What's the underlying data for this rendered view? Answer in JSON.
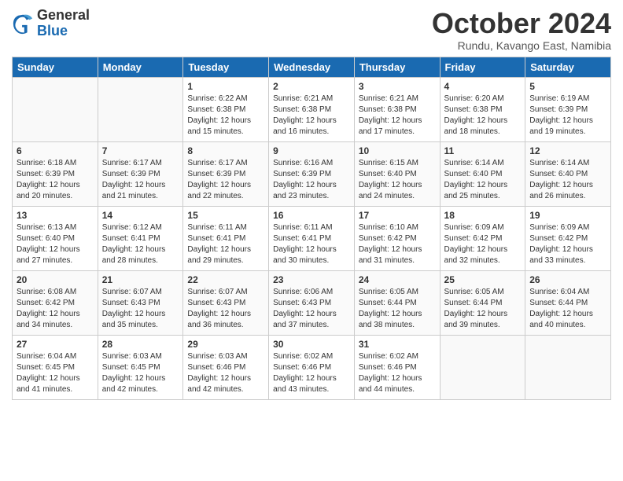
{
  "logo": {
    "general": "General",
    "blue": "Blue"
  },
  "header": {
    "month": "October 2024",
    "location": "Rundu, Kavango East, Namibia"
  },
  "days_of_week": [
    "Sunday",
    "Monday",
    "Tuesday",
    "Wednesday",
    "Thursday",
    "Friday",
    "Saturday"
  ],
  "weeks": [
    [
      {
        "day": "",
        "sunrise": "",
        "sunset": "",
        "daylight": ""
      },
      {
        "day": "",
        "sunrise": "",
        "sunset": "",
        "daylight": ""
      },
      {
        "day": "1",
        "sunrise": "Sunrise: 6:22 AM",
        "sunset": "Sunset: 6:38 PM",
        "daylight": "Daylight: 12 hours and 15 minutes."
      },
      {
        "day": "2",
        "sunrise": "Sunrise: 6:21 AM",
        "sunset": "Sunset: 6:38 PM",
        "daylight": "Daylight: 12 hours and 16 minutes."
      },
      {
        "day": "3",
        "sunrise": "Sunrise: 6:21 AM",
        "sunset": "Sunset: 6:38 PM",
        "daylight": "Daylight: 12 hours and 17 minutes."
      },
      {
        "day": "4",
        "sunrise": "Sunrise: 6:20 AM",
        "sunset": "Sunset: 6:38 PM",
        "daylight": "Daylight: 12 hours and 18 minutes."
      },
      {
        "day": "5",
        "sunrise": "Sunrise: 6:19 AM",
        "sunset": "Sunset: 6:39 PM",
        "daylight": "Daylight: 12 hours and 19 minutes."
      }
    ],
    [
      {
        "day": "6",
        "sunrise": "Sunrise: 6:18 AM",
        "sunset": "Sunset: 6:39 PM",
        "daylight": "Daylight: 12 hours and 20 minutes."
      },
      {
        "day": "7",
        "sunrise": "Sunrise: 6:17 AM",
        "sunset": "Sunset: 6:39 PM",
        "daylight": "Daylight: 12 hours and 21 minutes."
      },
      {
        "day": "8",
        "sunrise": "Sunrise: 6:17 AM",
        "sunset": "Sunset: 6:39 PM",
        "daylight": "Daylight: 12 hours and 22 minutes."
      },
      {
        "day": "9",
        "sunrise": "Sunrise: 6:16 AM",
        "sunset": "Sunset: 6:39 PM",
        "daylight": "Daylight: 12 hours and 23 minutes."
      },
      {
        "day": "10",
        "sunrise": "Sunrise: 6:15 AM",
        "sunset": "Sunset: 6:40 PM",
        "daylight": "Daylight: 12 hours and 24 minutes."
      },
      {
        "day": "11",
        "sunrise": "Sunrise: 6:14 AM",
        "sunset": "Sunset: 6:40 PM",
        "daylight": "Daylight: 12 hours and 25 minutes."
      },
      {
        "day": "12",
        "sunrise": "Sunrise: 6:14 AM",
        "sunset": "Sunset: 6:40 PM",
        "daylight": "Daylight: 12 hours and 26 minutes."
      }
    ],
    [
      {
        "day": "13",
        "sunrise": "Sunrise: 6:13 AM",
        "sunset": "Sunset: 6:40 PM",
        "daylight": "Daylight: 12 hours and 27 minutes."
      },
      {
        "day": "14",
        "sunrise": "Sunrise: 6:12 AM",
        "sunset": "Sunset: 6:41 PM",
        "daylight": "Daylight: 12 hours and 28 minutes."
      },
      {
        "day": "15",
        "sunrise": "Sunrise: 6:11 AM",
        "sunset": "Sunset: 6:41 PM",
        "daylight": "Daylight: 12 hours and 29 minutes."
      },
      {
        "day": "16",
        "sunrise": "Sunrise: 6:11 AM",
        "sunset": "Sunset: 6:41 PM",
        "daylight": "Daylight: 12 hours and 30 minutes."
      },
      {
        "day": "17",
        "sunrise": "Sunrise: 6:10 AM",
        "sunset": "Sunset: 6:42 PM",
        "daylight": "Daylight: 12 hours and 31 minutes."
      },
      {
        "day": "18",
        "sunrise": "Sunrise: 6:09 AM",
        "sunset": "Sunset: 6:42 PM",
        "daylight": "Daylight: 12 hours and 32 minutes."
      },
      {
        "day": "19",
        "sunrise": "Sunrise: 6:09 AM",
        "sunset": "Sunset: 6:42 PM",
        "daylight": "Daylight: 12 hours and 33 minutes."
      }
    ],
    [
      {
        "day": "20",
        "sunrise": "Sunrise: 6:08 AM",
        "sunset": "Sunset: 6:42 PM",
        "daylight": "Daylight: 12 hours and 34 minutes."
      },
      {
        "day": "21",
        "sunrise": "Sunrise: 6:07 AM",
        "sunset": "Sunset: 6:43 PM",
        "daylight": "Daylight: 12 hours and 35 minutes."
      },
      {
        "day": "22",
        "sunrise": "Sunrise: 6:07 AM",
        "sunset": "Sunset: 6:43 PM",
        "daylight": "Daylight: 12 hours and 36 minutes."
      },
      {
        "day": "23",
        "sunrise": "Sunrise: 6:06 AM",
        "sunset": "Sunset: 6:43 PM",
        "daylight": "Daylight: 12 hours and 37 minutes."
      },
      {
        "day": "24",
        "sunrise": "Sunrise: 6:05 AM",
        "sunset": "Sunset: 6:44 PM",
        "daylight": "Daylight: 12 hours and 38 minutes."
      },
      {
        "day": "25",
        "sunrise": "Sunrise: 6:05 AM",
        "sunset": "Sunset: 6:44 PM",
        "daylight": "Daylight: 12 hours and 39 minutes."
      },
      {
        "day": "26",
        "sunrise": "Sunrise: 6:04 AM",
        "sunset": "Sunset: 6:44 PM",
        "daylight": "Daylight: 12 hours and 40 minutes."
      }
    ],
    [
      {
        "day": "27",
        "sunrise": "Sunrise: 6:04 AM",
        "sunset": "Sunset: 6:45 PM",
        "daylight": "Daylight: 12 hours and 41 minutes."
      },
      {
        "day": "28",
        "sunrise": "Sunrise: 6:03 AM",
        "sunset": "Sunset: 6:45 PM",
        "daylight": "Daylight: 12 hours and 42 minutes."
      },
      {
        "day": "29",
        "sunrise": "Sunrise: 6:03 AM",
        "sunset": "Sunset: 6:46 PM",
        "daylight": "Daylight: 12 hours and 42 minutes."
      },
      {
        "day": "30",
        "sunrise": "Sunrise: 6:02 AM",
        "sunset": "Sunset: 6:46 PM",
        "daylight": "Daylight: 12 hours and 43 minutes."
      },
      {
        "day": "31",
        "sunrise": "Sunrise: 6:02 AM",
        "sunset": "Sunset: 6:46 PM",
        "daylight": "Daylight: 12 hours and 44 minutes."
      },
      {
        "day": "",
        "sunrise": "",
        "sunset": "",
        "daylight": ""
      },
      {
        "day": "",
        "sunrise": "",
        "sunset": "",
        "daylight": ""
      }
    ]
  ]
}
